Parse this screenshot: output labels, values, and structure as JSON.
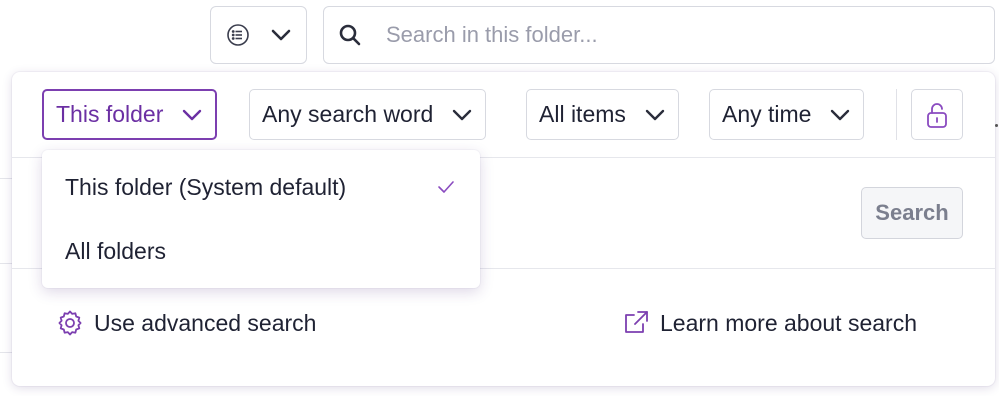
{
  "toolbar": {
    "view_icon": "list-icon",
    "view_chevron": "chevron-down-icon"
  },
  "search": {
    "placeholder": "Search in this folder...",
    "value": "",
    "icon": "search-icon"
  },
  "filters": {
    "scope": {
      "label": "This folder",
      "active": true
    },
    "words": {
      "label": "Any search word"
    },
    "items": {
      "label": "All items"
    },
    "time": {
      "label": "Any time"
    },
    "lock_icon": "unlock-icon"
  },
  "dropdown": {
    "items": [
      {
        "label": "This folder (System default)",
        "selected": true
      },
      {
        "label": "All folders",
        "selected": false
      }
    ]
  },
  "actions": {
    "search_button": "Search",
    "advanced_search": "Use advanced search",
    "learn_more": "Learn more about search"
  },
  "colors": {
    "accent": "#7c3fb0",
    "text": "#1f2233",
    "placeholder": "#9a9cab"
  }
}
